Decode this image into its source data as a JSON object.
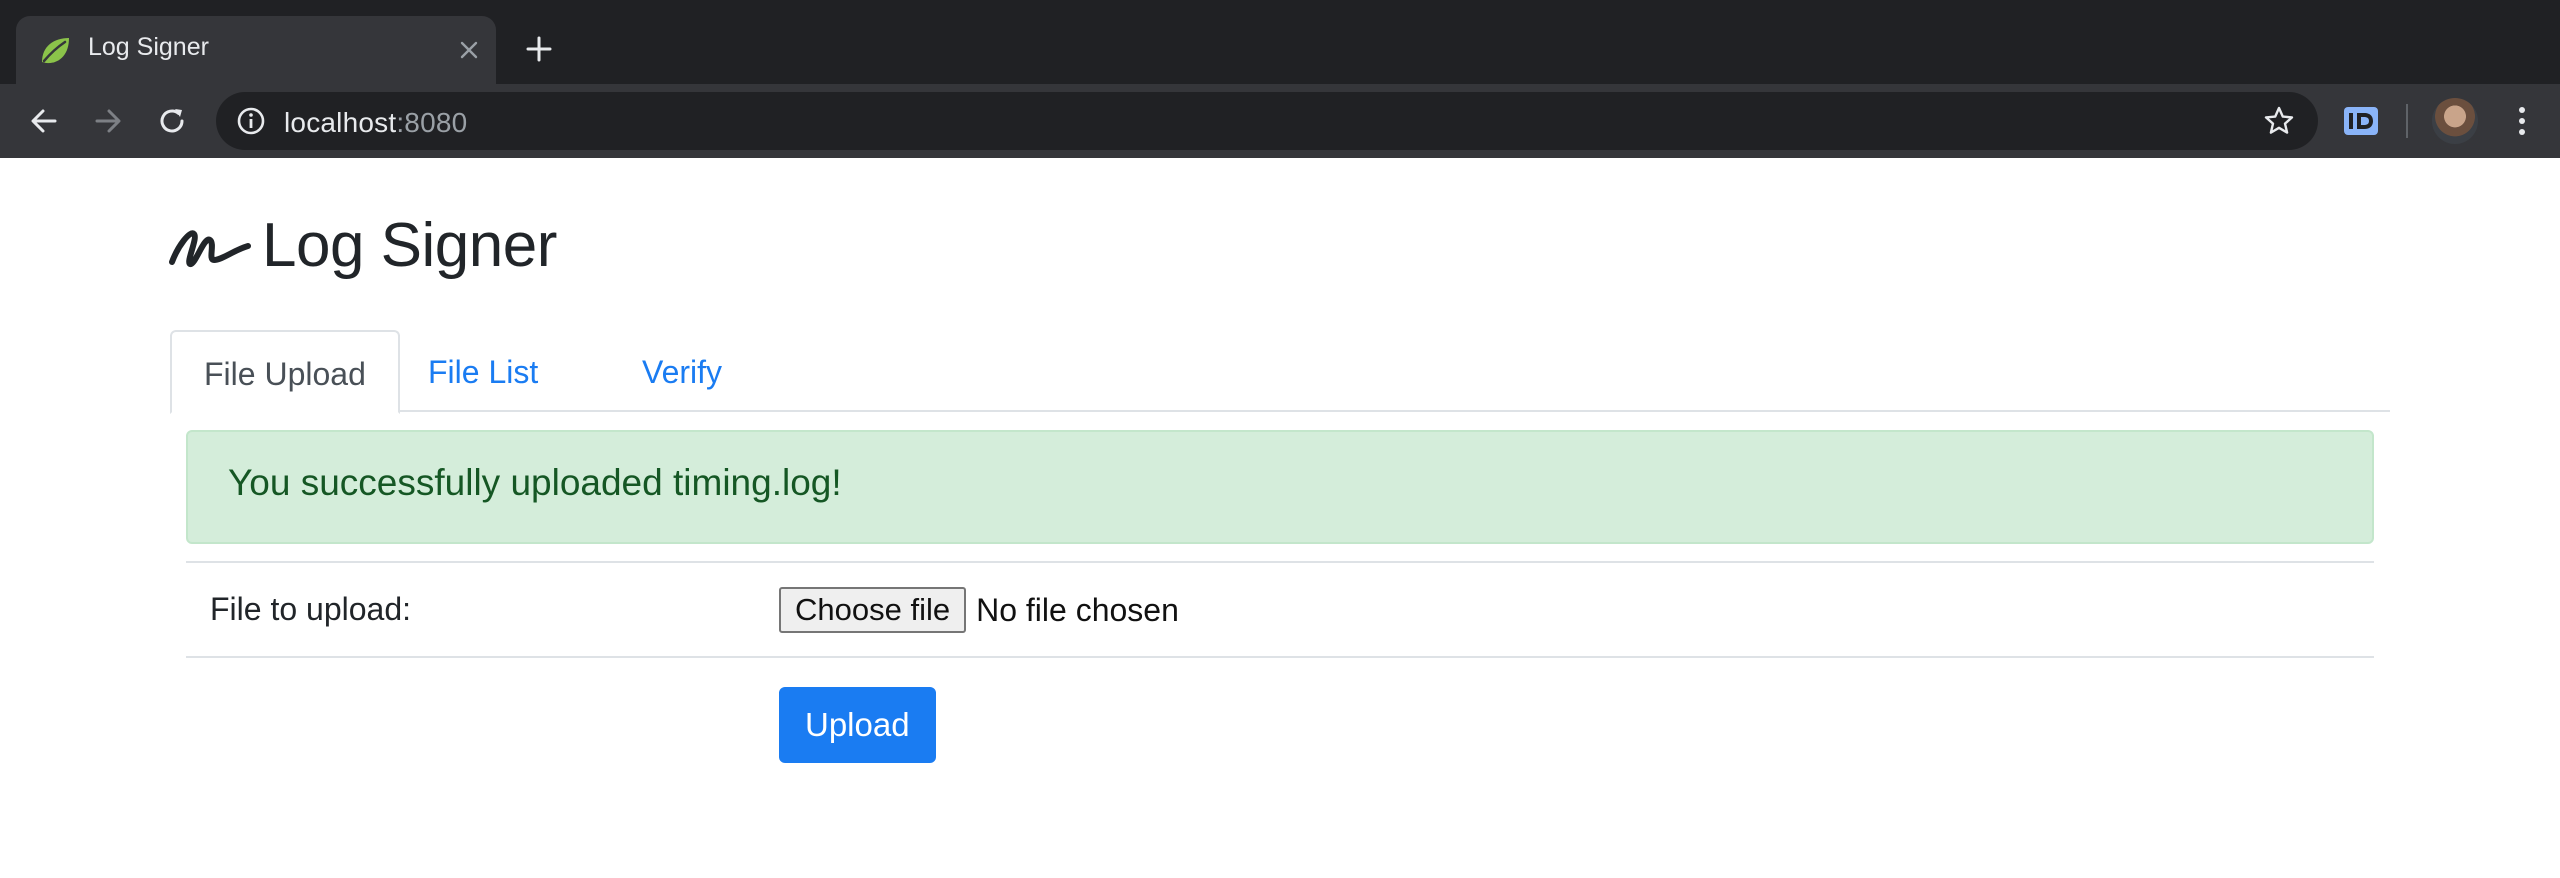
{
  "browser": {
    "tab_title": "Log Signer",
    "url_host": "localhost",
    "url_port": ":8080",
    "icons": {
      "favicon": "spring-leaf-icon",
      "tab_close": "close-icon",
      "new_tab": "plus-icon",
      "back": "arrow-left-icon",
      "forward": "arrow-right-icon",
      "reload": "reload-icon",
      "site_info": "info-icon",
      "bookmark": "star-icon",
      "extension": "id-extension-icon",
      "menu": "kebab-menu-icon"
    }
  },
  "page": {
    "brand_title": "Log Signer",
    "brand_icon": "signature-icon",
    "tabs": [
      {
        "label": "File Upload",
        "active": true
      },
      {
        "label": "File List",
        "active": false
      },
      {
        "label": "Verify",
        "active": false
      }
    ],
    "alert": {
      "message": "You successfully uploaded timing.log!"
    },
    "form": {
      "file_label": "File to upload:",
      "choose_file_label": "Choose file",
      "no_file_text": "No file chosen",
      "upload_button": "Upload"
    }
  },
  "colors": {
    "link": "#1a7cf2",
    "alert_bg": "#d4edda",
    "alert_text": "#155724",
    "primary_button": "#1a7cf2"
  }
}
